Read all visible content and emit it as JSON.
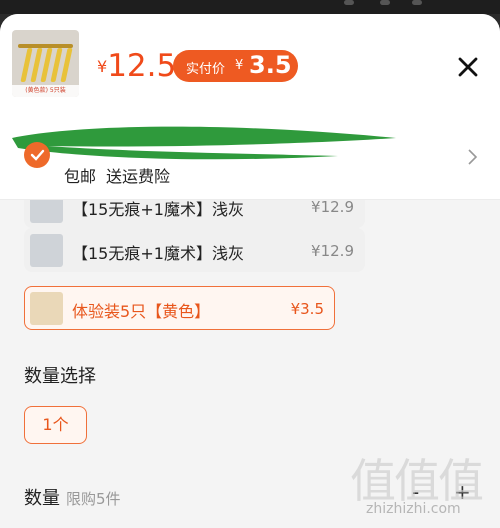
{
  "header": {
    "thumb_caption": "(黄色款) 5只装",
    "price_currency": "¥",
    "price_value": "12.5",
    "real_price_label": "实付价",
    "real_price_currency": "¥",
    "real_price_value": "3.5"
  },
  "shipping": {
    "free_shipping": "包邮",
    "insurance": "送运费险"
  },
  "options": [
    {
      "label": "【15无痕+1魔术】浅灰",
      "price": "¥12.9"
    },
    {
      "label": "【15无痕+1魔术】浅灰",
      "price": "¥12.9"
    },
    {
      "label": "体验装5只【黄色】",
      "price": "¥3.5"
    }
  ],
  "quantity_select": {
    "title": "数量选择",
    "chip": "1个"
  },
  "quantity": {
    "title": "数量",
    "limit": "限购5件",
    "minus": "-",
    "plus": "+"
  },
  "watermark": {
    "glyphs": "值值值",
    "url": "zhizhizhi.com"
  },
  "colors": {
    "accent": "#f04a1a",
    "badge": "#ee5a22",
    "selected_border": "#f0703a",
    "scribble": "#2f9a3c"
  }
}
